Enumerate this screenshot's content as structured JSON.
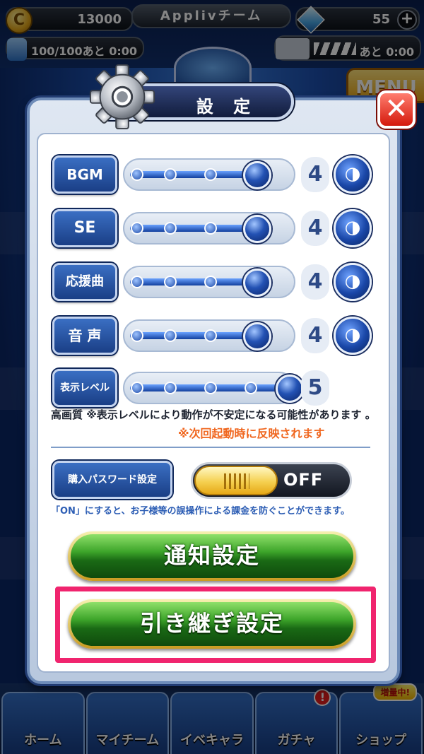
{
  "header": {
    "coin_value": "13000",
    "team_name": "Applivチーム",
    "gem_value": "55",
    "gem_plus": "+",
    "stamina": "100/100あと 0:00",
    "bp_time": "あと 0:00",
    "menu_label": "MENU"
  },
  "dialog": {
    "title": "設 定",
    "close_icon": "close-icon",
    "sliders": [
      {
        "label": "BGM",
        "value": "4",
        "level": 4,
        "max": 5,
        "has_speaker": true
      },
      {
        "label": "SE",
        "value": "4",
        "level": 4,
        "max": 5,
        "has_speaker": true
      },
      {
        "label": "応援曲",
        "value": "4",
        "level": 4,
        "max": 5,
        "has_speaker": true
      },
      {
        "label": "音 声",
        "value": "4",
        "level": 4,
        "max": 5,
        "has_speaker": true
      },
      {
        "label": "表示レベル",
        "value": "5",
        "level": 5,
        "max": 5,
        "has_speaker": false
      }
    ],
    "quality_note": "高画質 ※表示レベルにより動作が不安定になる可能性があります 。",
    "restart_note": "※次回起動時に反映されます",
    "password_label": "購入パスワード設定",
    "password_toggle": "OFF",
    "password_note": "「ON」にすると、お子様等の誤操作による課金を防ぐことができます。",
    "notification_button": "通知設定",
    "transfer_button": "引き継ぎ設定"
  },
  "bottom_nav": [
    {
      "label": "ホーム"
    },
    {
      "label": "マイチーム"
    },
    {
      "label": "イベキャラ"
    },
    {
      "label": "ガチャ"
    },
    {
      "label": "ショップ"
    }
  ],
  "bottom_nav_badge": "増量中!",
  "colors": {
    "highlight": "#f0246e",
    "note_red": "#f0661e",
    "note_blue": "#2c5db4"
  }
}
